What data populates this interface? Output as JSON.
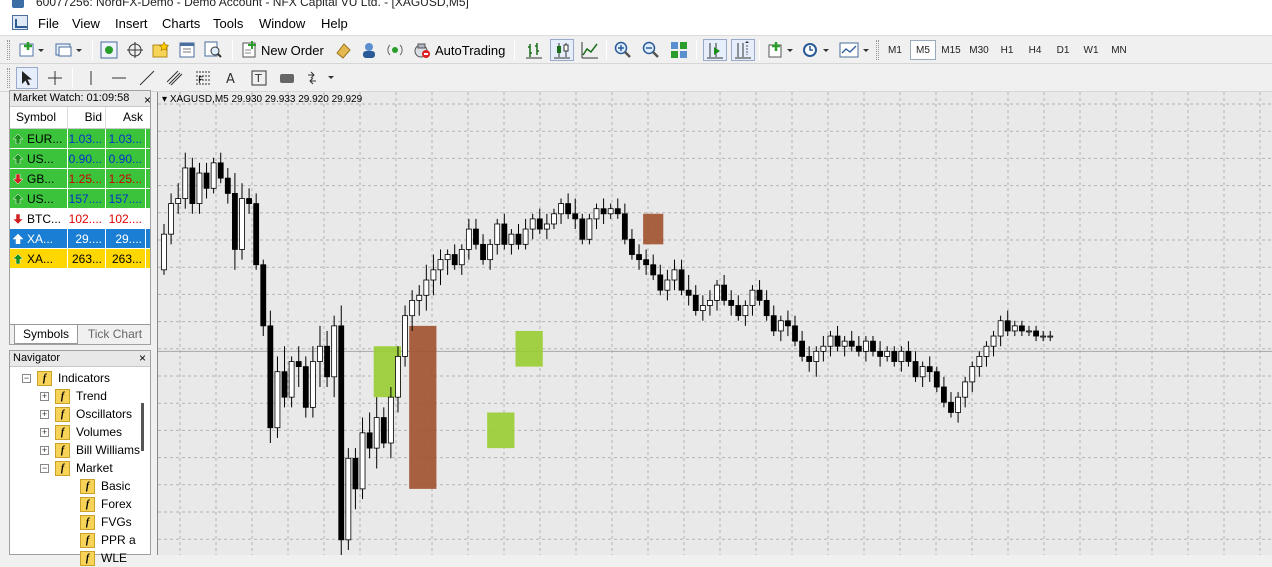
{
  "window": {
    "title": "60077256: NordFX-Demo - Demo Account - NFX Capital VU Ltd. - [XAGUSD,M5]"
  },
  "menu": [
    "File",
    "View",
    "Insert",
    "Charts",
    "Tools",
    "Window",
    "Help"
  ],
  "toolbar": {
    "new_order": "New Order",
    "auto_trading": "AutoTrading",
    "timeframes": [
      "M1",
      "M5",
      "M15",
      "M30",
      "H1",
      "H4",
      "D1",
      "W1",
      "MN"
    ],
    "active_timeframe": "M5"
  },
  "market_watch": {
    "title": "Market Watch: 01:09:58",
    "columns": [
      "Symbol",
      "Bid",
      "Ask"
    ],
    "rows": [
      {
        "symbol": "EUR...",
        "bid": "1.03...",
        "ask": "1.03...",
        "dir": "up",
        "bg": "#3cc33c",
        "color": "#0033cc"
      },
      {
        "symbol": "US...",
        "bid": "0.90...",
        "ask": "0.90...",
        "dir": "up",
        "bg": "#3cc33c",
        "color": "#0033cc"
      },
      {
        "symbol": "GB...",
        "bid": "1.25...",
        "ask": "1.25...",
        "dir": "down",
        "bg": "#3cc33c",
        "color": "#cc0000"
      },
      {
        "symbol": "US...",
        "bid": "157....",
        "ask": "157....",
        "dir": "up",
        "bg": "#3cc33c",
        "color": "#0033cc"
      },
      {
        "symbol": "BTC...",
        "bid": "102....",
        "ask": "102....",
        "dir": "down",
        "bg": "#ffffff",
        "color": "#dd0000"
      },
      {
        "symbol": "XA...",
        "bid": "29....",
        "ask": "29....",
        "dir": "up",
        "bg": "#1a7fd4",
        "color": "#ffffff"
      },
      {
        "symbol": "XA...",
        "bid": "263...",
        "ask": "263...",
        "dir": "up",
        "bg": "#ffd700",
        "color": "#000000"
      }
    ],
    "tabs": [
      "Symbols",
      "Tick Chart"
    ],
    "active_tab": "Symbols"
  },
  "navigator": {
    "title": "Navigator",
    "items": [
      {
        "label": "Indicators",
        "level": 1,
        "expander": "−"
      },
      {
        "label": "Trend",
        "level": 2,
        "expander": "+"
      },
      {
        "label": "Oscillators",
        "level": 2,
        "expander": "+"
      },
      {
        "label": "Volumes",
        "level": 2,
        "expander": "+"
      },
      {
        "label": "Bill Williams",
        "level": 2,
        "expander": "+"
      },
      {
        "label": "Market",
        "level": 2,
        "expander": "−"
      },
      {
        "label": "Basic",
        "level": 3,
        "expander": ""
      },
      {
        "label": "Forex",
        "level": 3,
        "expander": ""
      },
      {
        "label": "FVGs",
        "level": 3,
        "expander": ""
      },
      {
        "label": "PPR a",
        "level": 3,
        "expander": ""
      },
      {
        "label": "WLE",
        "level": 3,
        "expander": ""
      }
    ]
  },
  "chart": {
    "header": "XAGUSD,M5  29.930 29.933 29.920 29.929",
    "colors": {
      "background": "#e9e9e9",
      "grid": "#b4b4b4",
      "bull_zone": "#9acd32",
      "bear_zone": "#a0522d"
    }
  },
  "chart_data": {
    "type": "candlestick",
    "symbol": "XAGUSD",
    "timeframe": "M5",
    "ohlc_last": {
      "open": 29.93,
      "high": 29.933,
      "low": 29.92,
      "close": 29.929
    },
    "y_min": 29.4,
    "y_max": 30.25,
    "candles": [
      [
        29.95,
        30.04,
        29.94,
        30.02
      ],
      [
        30.02,
        30.1,
        30.0,
        30.08
      ],
      [
        30.08,
        30.12,
        30.06,
        30.09
      ],
      [
        30.09,
        30.18,
        30.07,
        30.15
      ],
      [
        30.15,
        30.17,
        30.06,
        30.08
      ],
      [
        30.08,
        30.16,
        30.06,
        30.14
      ],
      [
        30.14,
        30.16,
        30.09,
        30.11
      ],
      [
        30.11,
        30.17,
        30.1,
        30.16
      ],
      [
        30.16,
        30.18,
        30.12,
        30.13
      ],
      [
        30.13,
        30.15,
        30.08,
        30.1
      ],
      [
        30.1,
        30.14,
        29.95,
        29.99
      ],
      [
        29.99,
        30.12,
        29.97,
        30.09
      ],
      [
        30.09,
        30.11,
        30.06,
        30.08
      ],
      [
        30.08,
        30.1,
        29.95,
        29.96
      ],
      [
        29.96,
        29.97,
        29.82,
        29.84
      ],
      [
        29.84,
        29.87,
        29.61,
        29.64
      ],
      [
        29.64,
        29.78,
        29.62,
        29.75
      ],
      [
        29.75,
        29.8,
        29.68,
        29.7
      ],
      [
        29.7,
        29.78,
        29.68,
        29.77
      ],
      [
        29.77,
        29.8,
        29.72,
        29.76
      ],
      [
        29.76,
        29.78,
        29.66,
        29.68
      ],
      [
        29.68,
        29.8,
        29.66,
        29.77
      ],
      [
        29.77,
        29.84,
        29.72,
        29.8
      ],
      [
        29.8,
        29.83,
        29.72,
        29.74
      ],
      [
        29.74,
        29.86,
        29.7,
        29.84
      ],
      [
        29.84,
        29.88,
        29.39,
        29.42
      ],
      [
        29.42,
        29.6,
        29.4,
        29.58
      ],
      [
        29.58,
        29.6,
        29.48,
        29.52
      ],
      [
        29.52,
        29.66,
        29.5,
        29.63
      ],
      [
        29.63,
        29.67,
        29.58,
        29.6
      ],
      [
        29.6,
        29.7,
        29.56,
        29.66
      ],
      [
        29.66,
        29.68,
        29.6,
        29.61
      ],
      [
        29.61,
        29.72,
        29.58,
        29.7
      ],
      [
        29.7,
        29.8,
        29.67,
        29.78
      ],
      [
        29.78,
        29.88,
        29.76,
        29.86
      ],
      [
        29.86,
        29.91,
        29.83,
        29.89
      ],
      [
        29.89,
        29.92,
        29.86,
        29.9
      ],
      [
        29.9,
        29.96,
        29.87,
        29.93
      ],
      [
        29.93,
        29.98,
        29.9,
        29.95
      ],
      [
        29.95,
        29.99,
        29.92,
        29.97
      ],
      [
        29.97,
        29.99,
        29.94,
        29.98
      ],
      [
        29.98,
        30.0,
        29.95,
        29.96
      ],
      [
        29.96,
        30.0,
        29.94,
        29.99
      ],
      [
        29.99,
        30.05,
        29.97,
        30.03
      ],
      [
        30.03,
        30.05,
        29.99,
        30.0
      ],
      [
        30.0,
        30.02,
        29.96,
        29.97
      ],
      [
        29.97,
        30.01,
        29.95,
        30.0
      ],
      [
        30.0,
        30.05,
        29.98,
        30.04
      ],
      [
        30.04,
        30.06,
        29.99,
        30.0
      ],
      [
        30.0,
        30.03,
        29.98,
        30.02
      ],
      [
        30.02,
        30.04,
        29.99,
        30.0
      ],
      [
        30.0,
        30.05,
        29.99,
        30.03
      ],
      [
        30.03,
        30.06,
        30.01,
        30.05
      ],
      [
        30.05,
        30.07,
        30.02,
        30.03
      ],
      [
        30.03,
        30.06,
        30.01,
        30.04
      ],
      [
        30.04,
        30.07,
        30.03,
        30.06
      ],
      [
        30.06,
        30.09,
        30.04,
        30.08
      ],
      [
        30.08,
        30.1,
        30.05,
        30.06
      ],
      [
        30.06,
        30.09,
        30.03,
        30.05
      ],
      [
        30.05,
        30.06,
        30.0,
        30.01
      ],
      [
        30.01,
        30.06,
        30.0,
        30.05
      ],
      [
        30.05,
        30.08,
        30.03,
        30.07
      ],
      [
        30.07,
        30.09,
        30.04,
        30.06
      ],
      [
        30.06,
        30.08,
        30.05,
        30.07
      ],
      [
        30.07,
        30.09,
        30.05,
        30.06
      ],
      [
        30.06,
        30.08,
        30.0,
        30.01
      ],
      [
        30.01,
        30.03,
        29.97,
        29.98
      ],
      [
        29.98,
        30.0,
        29.95,
        29.97
      ],
      [
        29.97,
        29.99,
        29.94,
        29.96
      ],
      [
        29.96,
        29.98,
        29.93,
        29.94
      ],
      [
        29.94,
        29.96,
        29.9,
        29.91
      ],
      [
        29.91,
        29.95,
        29.89,
        29.93
      ],
      [
        29.93,
        29.97,
        29.91,
        29.95
      ],
      [
        29.95,
        29.97,
        29.9,
        29.91
      ],
      [
        29.91,
        29.94,
        29.88,
        29.9
      ],
      [
        29.9,
        29.92,
        29.86,
        29.87
      ],
      [
        29.87,
        29.9,
        29.85,
        29.88
      ],
      [
        29.88,
        29.91,
        29.86,
        29.89
      ],
      [
        29.89,
        29.93,
        29.87,
        29.92
      ],
      [
        29.92,
        29.94,
        29.88,
        29.89
      ],
      [
        29.89,
        29.91,
        29.86,
        29.88
      ],
      [
        29.88,
        29.9,
        29.85,
        29.86
      ],
      [
        29.86,
        29.89,
        29.84,
        29.88
      ],
      [
        29.88,
        29.92,
        29.86,
        29.91
      ],
      [
        29.91,
        29.93,
        29.88,
        29.89
      ],
      [
        29.89,
        29.91,
        29.85,
        29.86
      ],
      [
        29.86,
        29.88,
        29.82,
        29.83
      ],
      [
        29.83,
        29.86,
        29.81,
        29.85
      ],
      [
        29.85,
        29.87,
        29.82,
        29.84
      ],
      [
        29.84,
        29.86,
        29.8,
        29.81
      ],
      [
        29.81,
        29.83,
        29.77,
        29.78
      ],
      [
        29.78,
        29.8,
        29.75,
        29.77
      ],
      [
        29.77,
        29.8,
        29.74,
        29.79
      ],
      [
        29.79,
        29.82,
        29.77,
        29.8
      ],
      [
        29.8,
        29.83,
        29.78,
        29.82
      ],
      [
        29.82,
        29.84,
        29.79,
        29.8
      ],
      [
        29.8,
        29.82,
        29.78,
        29.81
      ],
      [
        29.81,
        29.83,
        29.79,
        29.8
      ],
      [
        29.8,
        29.82,
        29.78,
        29.79
      ],
      [
        29.79,
        29.82,
        29.77,
        29.81
      ],
      [
        29.81,
        29.82,
        29.78,
        29.79
      ],
      [
        29.79,
        29.81,
        29.76,
        29.78
      ],
      [
        29.78,
        29.8,
        29.77,
        29.79
      ],
      [
        29.79,
        29.8,
        29.76,
        29.77
      ],
      [
        29.77,
        29.8,
        29.75,
        29.79
      ],
      [
        29.79,
        29.81,
        29.76,
        29.77
      ],
      [
        29.77,
        29.79,
        29.73,
        29.74
      ],
      [
        29.74,
        29.77,
        29.72,
        29.76
      ],
      [
        29.76,
        29.78,
        29.73,
        29.75
      ],
      [
        29.75,
        29.76,
        29.71,
        29.72
      ],
      [
        29.72,
        29.74,
        29.68,
        29.69
      ],
      [
        29.69,
        29.71,
        29.66,
        29.67
      ],
      [
        29.67,
        29.71,
        29.65,
        29.7
      ],
      [
        29.7,
        29.74,
        29.68,
        29.73
      ],
      [
        29.73,
        29.77,
        29.71,
        29.76
      ],
      [
        29.76,
        29.79,
        29.74,
        29.78
      ],
      [
        29.78,
        29.81,
        29.76,
        29.8
      ],
      [
        29.8,
        29.83,
        29.78,
        29.82
      ],
      [
        29.82,
        29.86,
        29.8,
        29.85
      ],
      [
        29.85,
        29.87,
        29.82,
        29.83
      ],
      [
        29.83,
        29.85,
        29.82,
        29.84
      ],
      [
        29.84,
        29.85,
        29.82,
        29.83
      ],
      [
        29.83,
        29.84,
        29.82,
        29.83
      ],
      [
        29.83,
        29.84,
        29.81,
        29.82
      ],
      [
        29.82,
        29.83,
        29.81,
        29.82
      ],
      [
        29.82,
        29.83,
        29.81,
        29.82
      ],
      [
        29.93,
        29.933,
        29.92,
        29.929
      ]
    ],
    "zones": [
      {
        "type": "bull",
        "from": 30,
        "to": 33,
        "low": 29.7,
        "high": 29.8
      },
      {
        "type": "bear",
        "from": 35,
        "to": 38,
        "low": 29.52,
        "high": 29.84
      },
      {
        "type": "bull",
        "from": 46,
        "to": 49,
        "low": 29.6,
        "high": 29.67
      },
      {
        "type": "bull",
        "from": 50,
        "to": 53,
        "low": 29.76,
        "high": 29.83
      },
      {
        "type": "bear",
        "from": 68,
        "to": 70,
        "low": 30.0,
        "high": 30.06
      }
    ]
  }
}
